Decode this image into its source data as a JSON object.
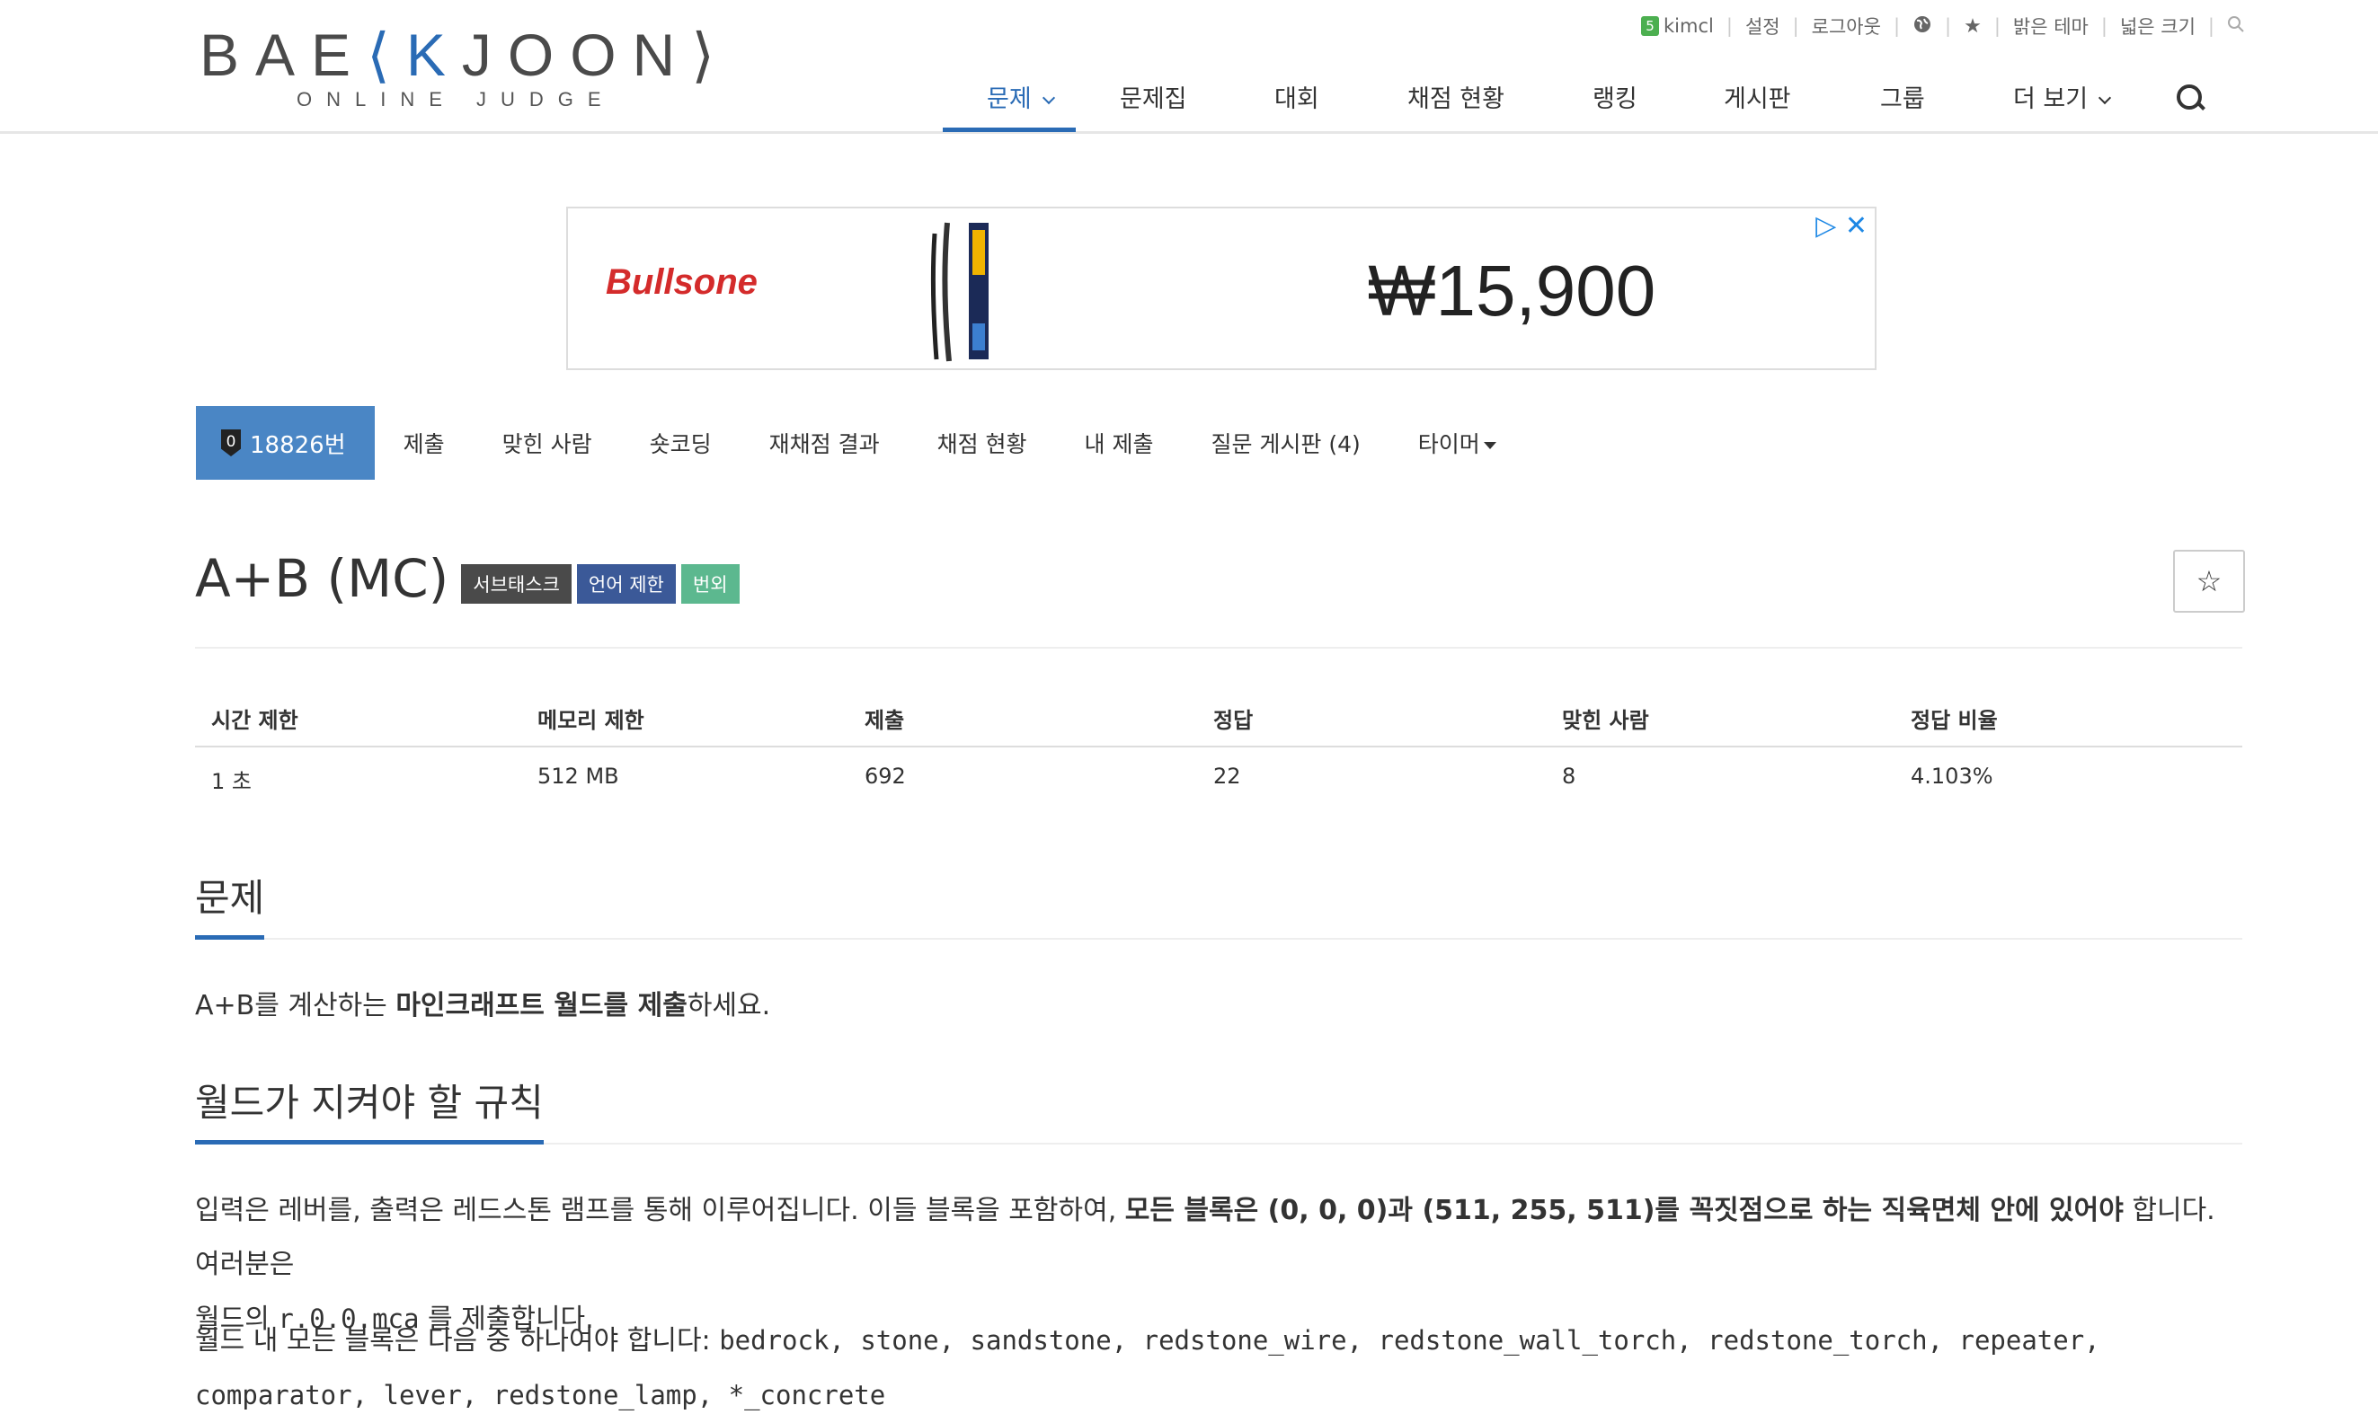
{
  "header": {
    "logo_main": "BAE",
    "logo_k": "⟨K",
    "logo_rest": "JOON⟩",
    "logo_sub": "ONLINE JUDGE",
    "top_links": {
      "user_tier": "5",
      "username": "kimcl",
      "settings": "설정",
      "logout": "로그아웃",
      "light_theme": "밝은 테마",
      "wide": "넓은 크기"
    },
    "nav": {
      "problems": "문제",
      "workbook": "문제집",
      "contest": "대회",
      "status": "채점 현황",
      "ranking": "랭킹",
      "board": "게시판",
      "group": "그룹",
      "more": "더 보기"
    }
  },
  "ad": {
    "brand": "Bullsone",
    "price": "₩15,900"
  },
  "problem_menu": {
    "tier": "0",
    "number": "18826번",
    "submit": "제출",
    "solved_users": "맞힌 사람",
    "shortcoding": "숏코딩",
    "rejudge": "재채점 결과",
    "status": "채점 현황",
    "my_submissions": "내 제출",
    "qna": "질문 게시판 (4)",
    "timer": "타이머"
  },
  "problem": {
    "title": "A+B (MC)",
    "labels": [
      {
        "text": "서브태스크",
        "color": "#4a4a4a"
      },
      {
        "text": "언어 제한",
        "color": "#3b5998"
      },
      {
        "text": "번외",
        "color": "#5cb88f"
      }
    ]
  },
  "info_table": {
    "headers": [
      "시간 제한",
      "메모리 제한",
      "제출",
      "정답",
      "맞힌 사람",
      "정답 비율"
    ],
    "values": [
      "1 초",
      "512 MB",
      "692",
      "22",
      "8",
      "4.103%"
    ]
  },
  "sections": {
    "problem_heading": "문제",
    "problem_text_1": "A+B를 계산하는 ",
    "problem_text_bold": "마인크래프트 월드를 제출",
    "problem_text_2": "하세요.",
    "rules_heading": "월드가 지켜야 할 규칙",
    "rules_p1_a": "입력은 레버를, 출력은 레드스톤 램프를 통해 이루어집니다. 이들 블록을 포함하여, ",
    "rules_p1_bold": "모든 블록은 (0, 0, 0)과 (511, 255, 511)를 꼭짓점으로 하는 직육면체 안에 있어야",
    "rules_p1_b": " 합니다. 여러분은",
    "rules_p1_c": "월드의 ",
    "rules_p1_code": "r.0.0.mca",
    "rules_p1_d": " 를 제출합니다.",
    "rules_p2_a": "월드 내 모든 블록은 다음 중 하나여야 합니다: ",
    "blocks_line1": "bedrock, stone, sandstone, redstone_wire, redstone_wall_torch, redstone_torch, repeater,",
    "blocks_line2": "comparator, lever, redstone_lamp, *_concrete"
  },
  "colors": {
    "accent": "#2a6bb5",
    "active_tab": "#4a86c5"
  }
}
